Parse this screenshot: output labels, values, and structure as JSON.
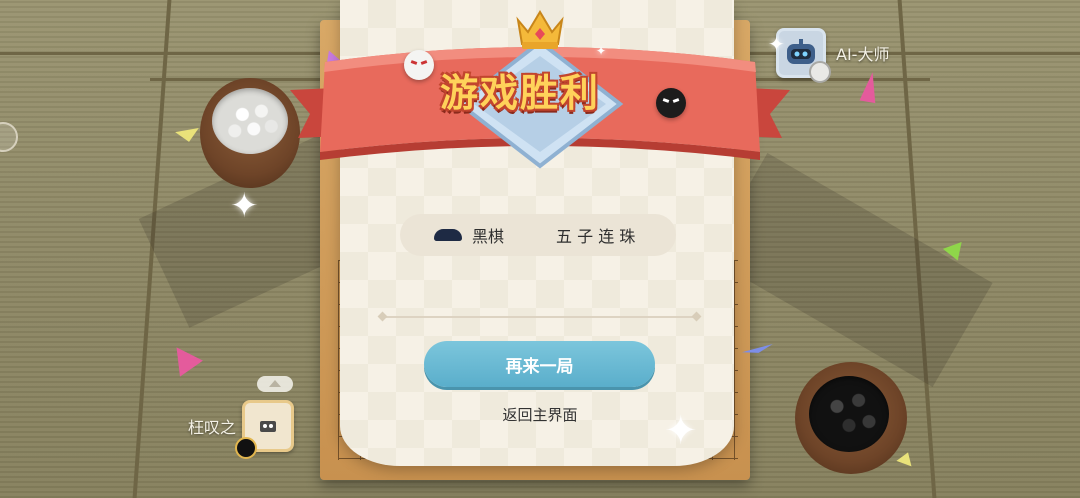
{
  "result": {
    "title": "游戏胜利"
  },
  "match_info": {
    "stone_color": "黑棋",
    "mode": "五 子 连 珠"
  },
  "actions": {
    "play_again": "再来一局",
    "return_home": "返回主界面"
  },
  "opponent": {
    "name": "AI-大师"
  },
  "self_player": {
    "name": "枉叹之"
  },
  "colors": {
    "banner_red": "#e86a5c",
    "title_gold": "#ffd25a",
    "button_blue": "#6bbcd6",
    "panel_cream": "#f6f1e6"
  }
}
